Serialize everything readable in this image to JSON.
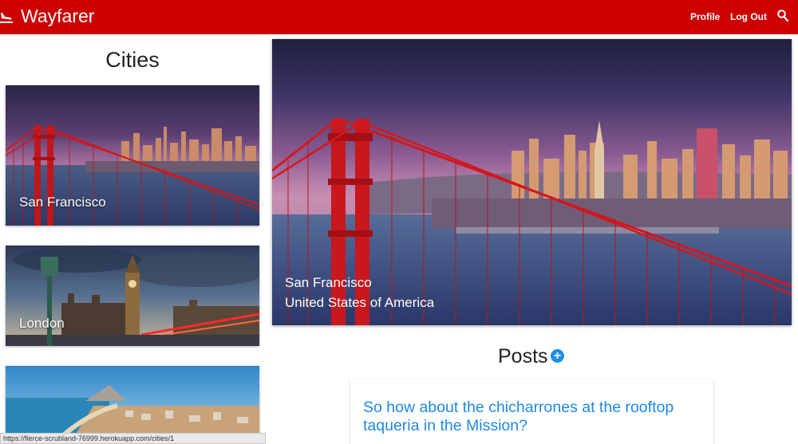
{
  "app": {
    "brand": "Wayfarer",
    "logo_icon": "airplane-landing-icon",
    "accent_color": "#cc0000"
  },
  "nav": {
    "profile": "Profile",
    "logout": "Log Out",
    "search_icon": "search-icon"
  },
  "sidebar": {
    "title": "Cities",
    "cities": [
      {
        "name": "San Francisco"
      },
      {
        "name": "London"
      },
      {
        "name": ""
      }
    ]
  },
  "hero": {
    "city": "San Francisco",
    "country": "United States of America"
  },
  "posts": {
    "title": "Posts",
    "add_icon": "plus-circle-icon",
    "items": [
      {
        "title": "So how about the chicharrones at the rooftop taqueria in the Mission?"
      }
    ]
  },
  "status_bar": {
    "url": "https://fierce-scrubland-76999.herokuapp.com/cities/1"
  }
}
